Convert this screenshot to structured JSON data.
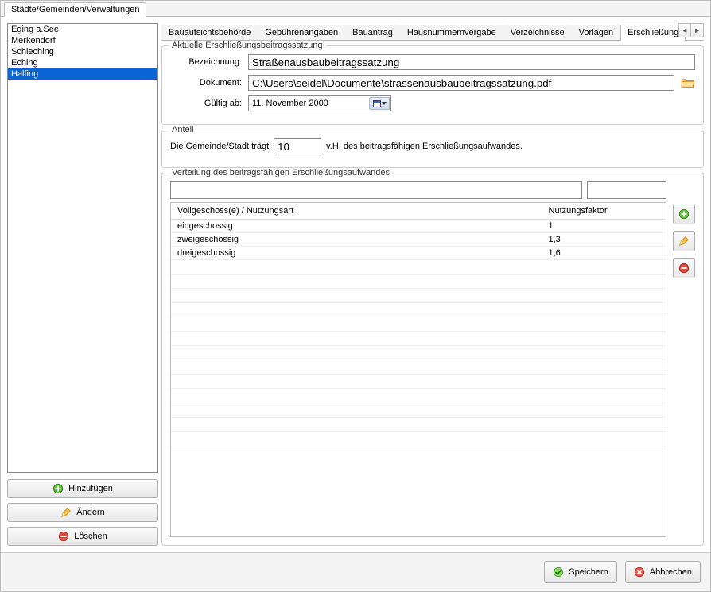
{
  "topTab": "Städte/Gemeinden/Verwaltungen",
  "sidebar": {
    "items": [
      "Eging a.See",
      "Merkendorf",
      "Schleching",
      "Eching",
      "Halfing"
    ],
    "selectedIndex": 4,
    "buttons": {
      "add": "Hinzufügen",
      "edit": "Ändern",
      "delete": "Löschen"
    }
  },
  "tabs": {
    "items": [
      "Bauaufsichtsbehörde",
      "Gebührenangaben",
      "Bauantrag",
      "Hausnummernvergabe",
      "Verzeichnisse",
      "Vorlagen",
      "Erschließung"
    ],
    "activeIndex": 6
  },
  "group_satzung": {
    "legend": "Aktuelle Erschließungsbeitragssatzung",
    "bezeichnung_label": "Bezeichnung:",
    "bezeichnung_value": "Straßenausbaubeitragssatzung",
    "dokument_label": "Dokument:",
    "dokument_value": "C:\\Users\\seidel\\Documente\\strassenausbaubeitragssatzung.pdf",
    "gueltig_label": "Gültig ab:",
    "gueltig_value": "11. November 2000"
  },
  "group_anteil": {
    "legend": "Anteil",
    "pre": "Die Gemeinde/Stadt trägt",
    "value": "10",
    "post": "v.H. des beitragsfähigen Erschließungsaufwandes."
  },
  "group_dist": {
    "legend": "Verteilung des beitragsfähigen Erschließungsaufwandes",
    "col1": "Vollgeschoss(e) / Nutzungsart",
    "col2": "Nutzungsfaktor",
    "rows": [
      {
        "a": "eingeschossig",
        "b": "1"
      },
      {
        "a": "zweigeschossig",
        "b": "1,3"
      },
      {
        "a": "dreigeschossig",
        "b": "1,6"
      }
    ]
  },
  "footer": {
    "save": "Speichern",
    "cancel": "Abbrechen"
  }
}
